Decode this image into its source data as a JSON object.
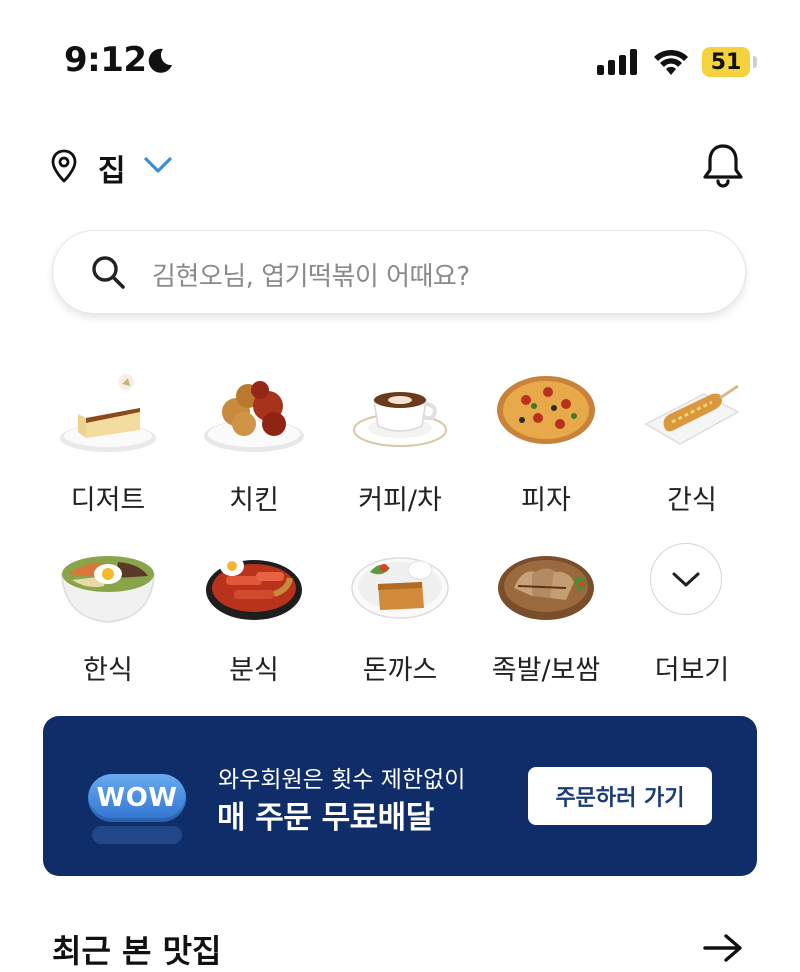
{
  "status_bar": {
    "time": "9:12",
    "battery": "51",
    "icons": [
      "moon-icon",
      "signal-icon",
      "wifi-icon",
      "battery-icon"
    ]
  },
  "header": {
    "location_label": "집",
    "icons": [
      "location-pin-icon",
      "chevron-down-icon",
      "bell-icon"
    ]
  },
  "search": {
    "placeholder": "김현오님, 엽기떡볶이 어때요?"
  },
  "categories": [
    {
      "label": "디저트"
    },
    {
      "label": "치킨"
    },
    {
      "label": "커피/차"
    },
    {
      "label": "피자"
    },
    {
      "label": "간식"
    },
    {
      "label": "한식"
    },
    {
      "label": "분식"
    },
    {
      "label": "돈까스"
    },
    {
      "label": "족발/보쌈"
    },
    {
      "label": "더보기"
    }
  ],
  "banner": {
    "badge": "WOW",
    "subtitle": "와우회원은 횟수 제한없이",
    "title": "매 주문 무료배달",
    "button": "주문하러 가기",
    "bg_color": "#0f2d68"
  },
  "recent": {
    "title": "최근 본 맛집"
  }
}
